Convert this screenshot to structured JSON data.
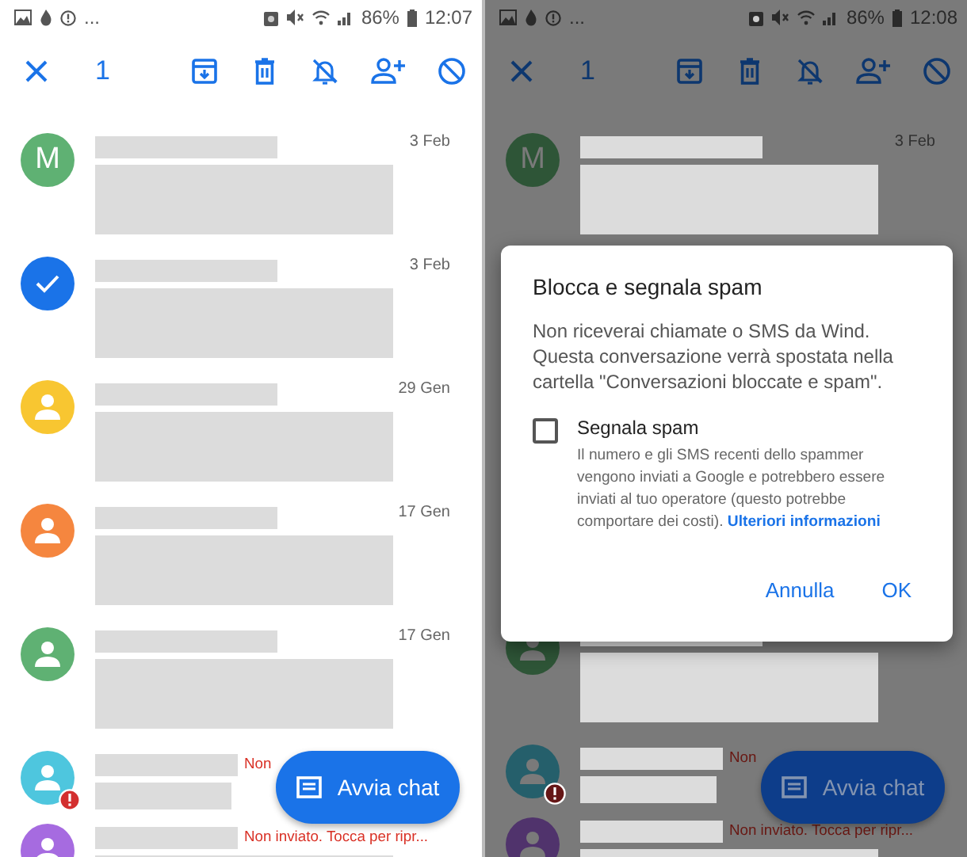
{
  "screens": [
    {
      "dimmed": false,
      "status_bar": {
        "overflow": "...",
        "battery": "86%",
        "time": "12:07"
      },
      "toolbar": {
        "selected_count": "1"
      },
      "conversations": [
        {
          "selected": false,
          "avatar": {
            "kind": "letter",
            "letter": "M",
            "color": "#5fb173"
          },
          "date": "3 Feb",
          "error": false
        },
        {
          "selected": true,
          "avatar": {
            "color": "#1a73e8"
          },
          "date": "3 Feb",
          "error": false
        },
        {
          "selected": false,
          "avatar": {
            "kind": "person",
            "color": "#f8c631"
          },
          "date": "29 Gen",
          "error": false
        },
        {
          "selected": false,
          "avatar": {
            "kind": "person",
            "color": "#f5863f"
          },
          "date": "17 Gen",
          "error": false
        },
        {
          "selected": false,
          "avatar": {
            "kind": "person",
            "color": "#5fb173"
          },
          "date": "17 Gen",
          "error": false
        },
        {
          "selected": false,
          "avatar": {
            "kind": "person",
            "color": "#4ec6de"
          },
          "status": "Non",
          "error": true
        },
        {
          "selected": false,
          "avatar": {
            "kind": "person",
            "color": "#a66be0"
          },
          "status": "Non inviato. Tocca per ripr...",
          "error": false
        }
      ],
      "fab": {
        "label": "Avvia chat"
      }
    },
    {
      "dimmed": true,
      "status_bar": {
        "overflow": "...",
        "battery": "86%",
        "time": "12:08"
      },
      "toolbar": {
        "selected_count": "1"
      },
      "conversations": [
        {
          "selected": false,
          "avatar": {
            "kind": "letter",
            "letter": "M",
            "color": "#2e5537"
          },
          "date": "3 Feb",
          "error": false
        },
        {
          "selected": false,
          "avatar": {
            "kind": "person",
            "color": "#2e5537"
          },
          "error": false
        },
        {
          "selected": false,
          "avatar": {
            "kind": "person",
            "color": "#255f6b"
          },
          "status": "Non",
          "error": true
        },
        {
          "selected": false,
          "avatar": {
            "kind": "person",
            "color": "#50336c"
          },
          "status": "Non inviato. Tocca per ripr...",
          "error": false
        }
      ],
      "fab": {
        "label": "Avvia chat"
      },
      "dialog": {
        "title": "Blocca e segnala spam",
        "message": "Non riceverai chiamate o SMS da Wind. Questa conversazione verrà spostata nella cartella \"Conversazioni bloccate e spam\".",
        "checkbox": {
          "label": "Segnala spam",
          "checked": false,
          "description": "Il numero e gli SMS recenti dello spammer vengono inviati a Google e potrebbero essere inviati al tuo operatore (questo potrebbe comportare dei costi).",
          "link": "Ulteriori informazioni"
        },
        "buttons": [
          "Annulla",
          "OK"
        ]
      }
    }
  ]
}
